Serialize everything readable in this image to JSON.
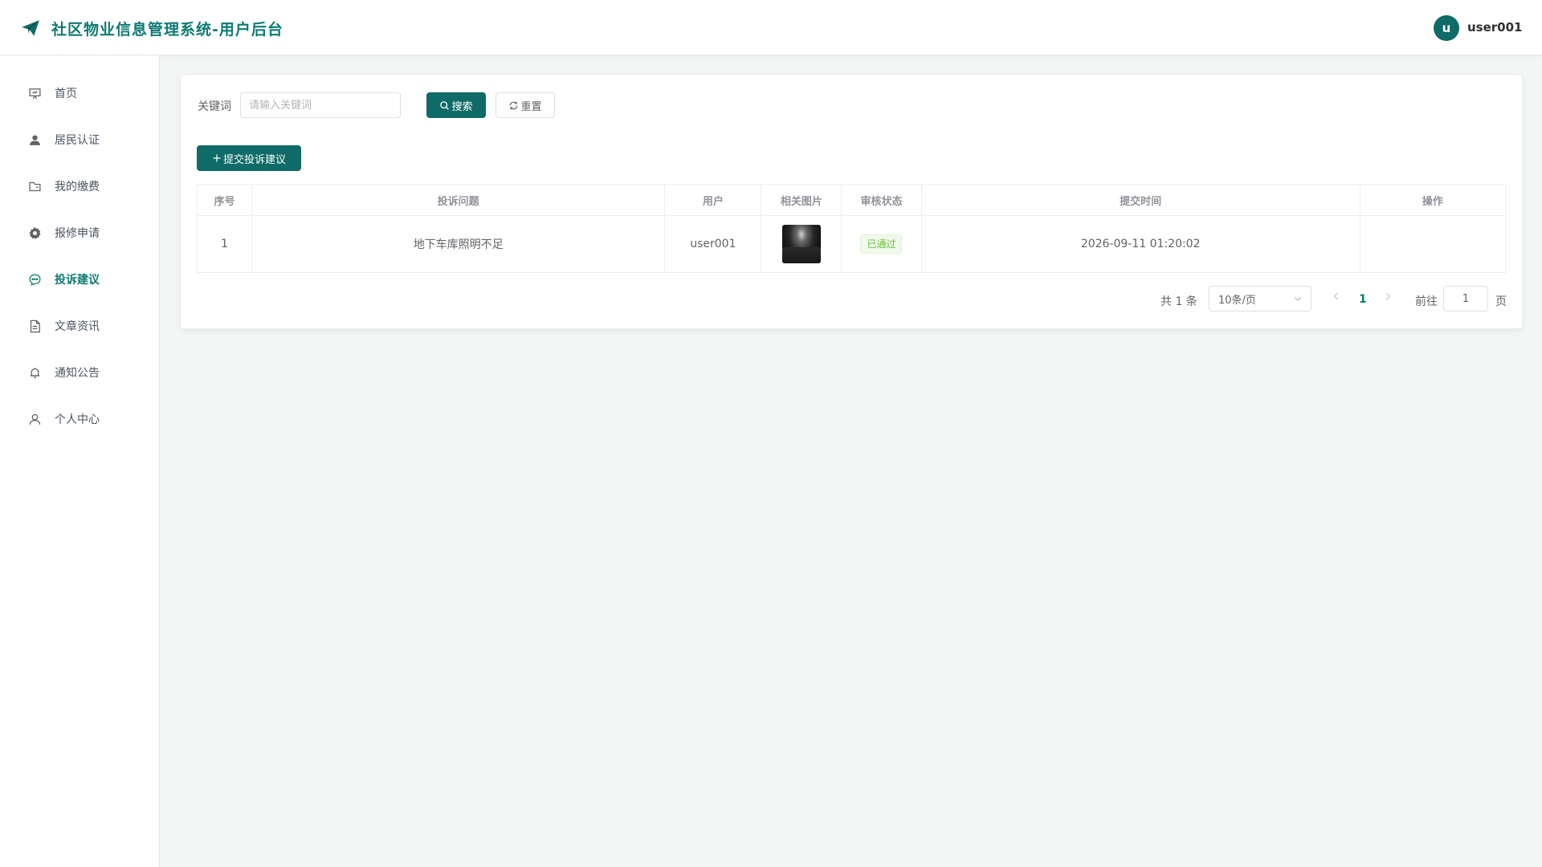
{
  "header": {
    "title": "社区物业信息管理系统-用户后台",
    "avatar_letter": "u",
    "username": "user001"
  },
  "sidebar": {
    "items": [
      {
        "label": "首页",
        "icon": "presentation-icon"
      },
      {
        "label": "居民认证",
        "icon": "user-filled-icon"
      },
      {
        "label": "我的缴费",
        "icon": "folder-icon"
      },
      {
        "label": "报修申请",
        "icon": "gear-icon"
      },
      {
        "label": "投诉建议",
        "icon": "chat-icon",
        "active": true
      },
      {
        "label": "文章资讯",
        "icon": "document-icon"
      },
      {
        "label": "通知公告",
        "icon": "bell-icon"
      },
      {
        "label": "个人中心",
        "icon": "user-icon"
      }
    ]
  },
  "search": {
    "label": "关键词",
    "placeholder": "请输入关键词",
    "value": "",
    "search_button": "搜索",
    "reset_button": "重置"
  },
  "toolbar": {
    "submit_button": "提交投诉建议"
  },
  "table": {
    "columns": [
      "序号",
      "投诉问题",
      "用户",
      "相关图片",
      "审核状态",
      "提交时间",
      "操作"
    ],
    "rows": [
      {
        "index": "1",
        "issue": "地下车库照明不足",
        "user": "user001",
        "image": "dark-garage-photo",
        "status": "已通过",
        "time": "2026-09-11 01:20:02",
        "actions": ""
      }
    ]
  },
  "pagination": {
    "total_text": "共 1 条",
    "page_size": "10条/页",
    "current_page": "1",
    "goto_label": "前往",
    "goto_value": "1",
    "page_suffix": "页"
  },
  "colors": {
    "primary": "#0e6b67",
    "title": "#0e7a74",
    "success": "#67c23a",
    "background": "#f4f6f5"
  }
}
